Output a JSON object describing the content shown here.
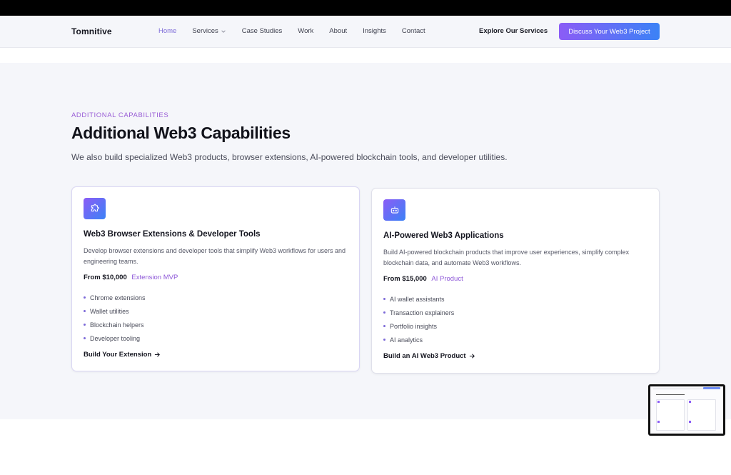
{
  "header": {
    "logo": "Tomnitive",
    "nav": [
      {
        "label": "Home",
        "active": true
      },
      {
        "label": "Services",
        "active": false,
        "has_dropdown": true
      },
      {
        "label": "Case Studies",
        "active": false
      },
      {
        "label": "Work",
        "active": false
      },
      {
        "label": "About",
        "active": false
      },
      {
        "label": "Insights",
        "active": false
      },
      {
        "label": "Contact",
        "active": false
      }
    ],
    "explore_label": "Explore Our Services",
    "cta_label": "Discuss Your Web3 Project"
  },
  "section": {
    "eyebrow": "ADDITIONAL CAPABILITIES",
    "title": "Additional Web3 Capabilities",
    "lead": "We also build specialized Web3 products, browser extensions, AI-powered blockchain tools, and developer utilities."
  },
  "cards": [
    {
      "icon": "puzzle-icon",
      "title": "Web3 Browser Extensions & Developer Tools",
      "description": "Develop browser extensions and developer tools that simplify Web3 workflows for users and engineering teams.",
      "price": "From $10,000",
      "tag": "Extension MVP",
      "features": [
        "Chrome extensions",
        "Wallet utilities",
        "Blockchain helpers",
        "Developer tooling"
      ],
      "link": "Build Your Extension"
    },
    {
      "icon": "robot-icon",
      "title": "AI-Powered Web3 Applications",
      "description": "Build AI-powered blockchain products that improve user experiences, simplify complex blockchain data, and automate Web3 workflows.",
      "price": "From $15,000",
      "tag": "AI Product",
      "features": [
        "AI wallet assistants",
        "Transaction explainers",
        "Portfolio insights",
        "AI analytics"
      ],
      "link": "Build an AI Web3 Product"
    }
  ],
  "colors": {
    "accent": "#7c6ad8",
    "gradient_start": "#8b5cf6",
    "gradient_end": "#3b82f6",
    "section_bg": "#f5f6fa"
  }
}
